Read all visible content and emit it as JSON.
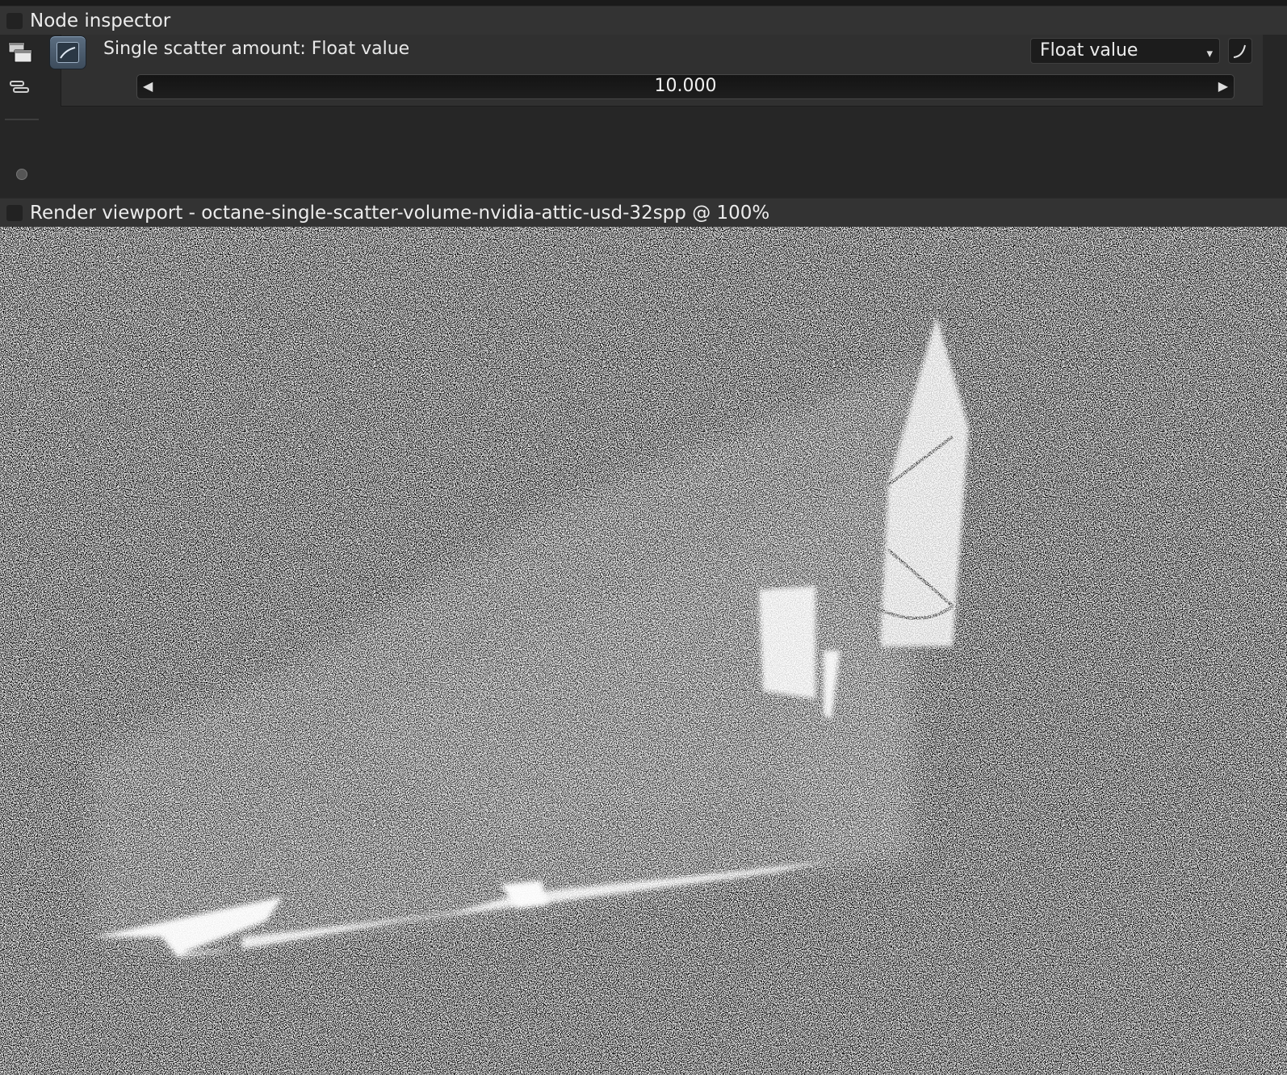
{
  "node_inspector": {
    "title": "Node inspector",
    "parameter": {
      "label": "Single scatter amount: Float value",
      "type_dropdown": "Float value",
      "value": "10.000"
    }
  },
  "render_viewport": {
    "title": "Render viewport - octane-single-scatter-volume-nvidia-attic-usd-32spp @ 100%"
  },
  "icons": {
    "left_arrow": "◀",
    "right_arrow": "▶",
    "dropdown_arrow": "▾"
  },
  "colors": {
    "panel_bg": "#262626",
    "header_bg": "#333333",
    "accent_icon": "#5b6d80"
  }
}
